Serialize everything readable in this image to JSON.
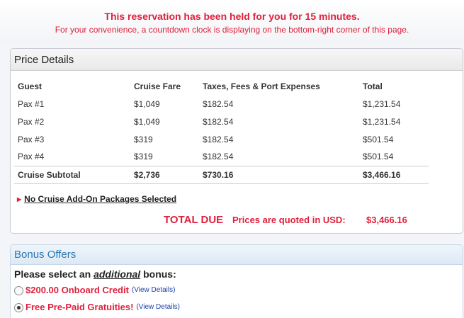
{
  "banner": {
    "title": "This reservation has been held for you for 15 minutes.",
    "subtitle": "For your convenience, a countdown clock is displaying on the bottom-right corner of this page."
  },
  "price_details": {
    "header": "Price Details",
    "columns": [
      "Guest",
      "Cruise Fare",
      "Taxes, Fees & Port Expenses",
      "Total"
    ],
    "rows": [
      [
        "Pax #1",
        "$1,049",
        "$182.54",
        "$1,231.54"
      ],
      [
        "Pax #2",
        "$1,049",
        "$182.54",
        "$1,231.54"
      ],
      [
        "Pax #3",
        "$319",
        "$182.54",
        "$501.54"
      ],
      [
        "Pax #4",
        "$319",
        "$182.54",
        "$501.54"
      ]
    ],
    "subtotal": [
      "Cruise Subtotal",
      "$2,736",
      "$730.16",
      "$3,466.16"
    ],
    "addon_link": "No Cruise Add-On Packages Selected",
    "total_label": "TOTAL DUE",
    "quoted_text": "Prices are quoted in USD:",
    "total_amount": "$3,466.16"
  },
  "bonus": {
    "header": "Bonus Offers",
    "prompt_before": "Please select an ",
    "prompt_em": "additional",
    "prompt_after": " bonus:",
    "options": [
      {
        "label": "$200.00 Onboard Credit",
        "link": "(View Details)",
        "selected": false
      },
      {
        "label": "Free Pre-Paid Gratuities!",
        "link": "(View Details)",
        "selected": true
      }
    ]
  },
  "colors": {
    "accent_red": "#e0203b",
    "link_blue": "#1a3fa8",
    "bonus_header": "#2f78b1"
  }
}
